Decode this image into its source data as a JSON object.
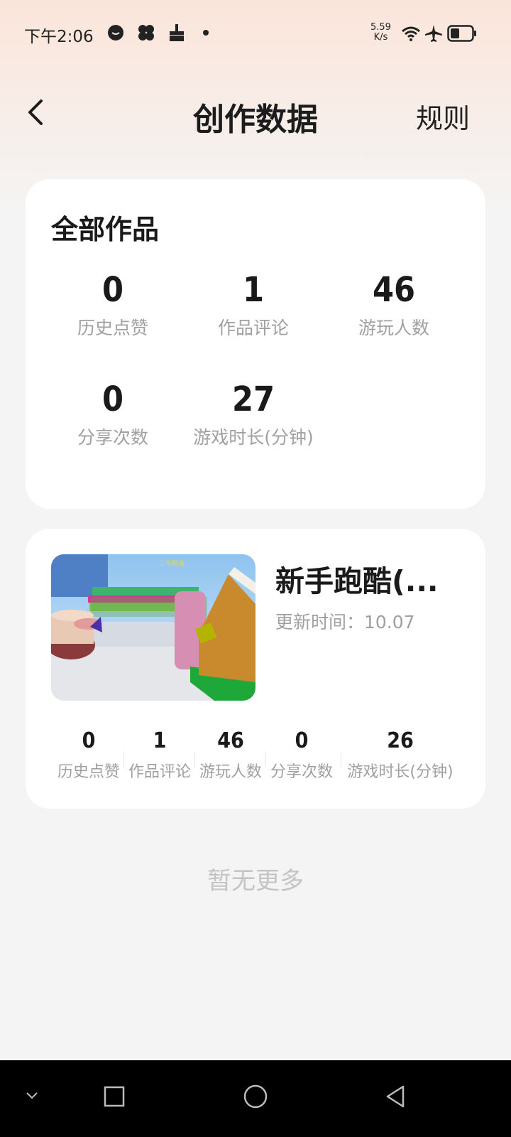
{
  "status_bar": {
    "time": "下午2:06",
    "net_speed_value": "5.59",
    "net_speed_unit": "K/s",
    "icons": [
      "chat-bubble-icon",
      "clover-icon",
      "broom-icon",
      "dot-icon",
      "wifi-icon",
      "airplane-icon",
      "battery-icon"
    ]
  },
  "header": {
    "title": "创作数据",
    "rules_label": "规则"
  },
  "all_works": {
    "title": "全部作品",
    "stats": [
      {
        "value": "0",
        "label": "历史点赞"
      },
      {
        "value": "1",
        "label": "作品评论"
      },
      {
        "value": "46",
        "label": "游玩人数"
      },
      {
        "value": "0",
        "label": "分享次数"
      },
      {
        "value": "27",
        "label": "游戏时长(分钟)"
      }
    ]
  },
  "work": {
    "title": "新手跑酷(...",
    "update_time": "更新时间：10.07",
    "thumbnail_text": "三号跑道",
    "stats": [
      {
        "value": "0",
        "label": "历史点赞"
      },
      {
        "value": "1",
        "label": "作品评论"
      },
      {
        "value": "46",
        "label": "游玩人数"
      },
      {
        "value": "0",
        "label": "分享次数"
      },
      {
        "value": "26",
        "label": "游戏时长(分钟)"
      }
    ]
  },
  "footer_text": "暂无更多",
  "nav_bar": {
    "icons": [
      "chevron-down-icon",
      "square-icon",
      "circle-icon",
      "triangle-back-icon"
    ]
  }
}
